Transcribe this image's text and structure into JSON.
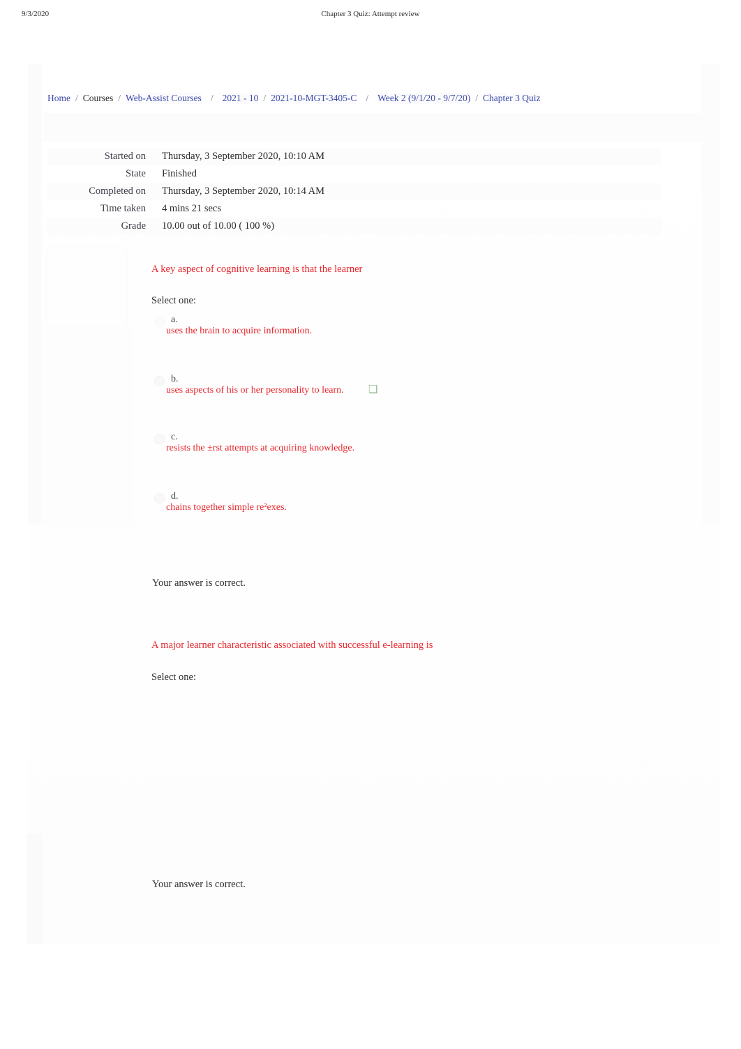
{
  "print_header": {
    "date": "9/3/2020",
    "title": "Chapter 3 Quiz: Attempt review"
  },
  "colors": {
    "link": "#3c4aa8",
    "question_text": "#e8262c",
    "body_text": "#2b2b2b",
    "correct_mark": "#8db48c",
    "page_background": "#ffffff"
  },
  "breadcrumb": {
    "items": [
      {
        "label": "Home",
        "type": "link"
      },
      {
        "label": "Courses",
        "type": "static"
      },
      {
        "label": "Web-Assist Courses",
        "type": "link"
      },
      {
        "label": "2021 - 10",
        "type": "link"
      },
      {
        "label": "2021-10-MGT-3405-C",
        "type": "link"
      },
      {
        "label": "Week 2  (9/1/20 - 9/7/20)",
        "type": "link"
      },
      {
        "label": "Chapter 3 Quiz",
        "type": "link"
      }
    ],
    "separator": "/"
  },
  "attempt_summary": {
    "rows": [
      {
        "label": "Started on",
        "value": "Thursday, 3 September 2020, 10:10 AM"
      },
      {
        "label": "State",
        "value": "Finished"
      },
      {
        "label": "Completed on",
        "value": "Thursday, 3 September 2020, 10:14 AM"
      },
      {
        "label": "Time taken",
        "value": "4 mins 21 secs"
      },
      {
        "label": "Grade",
        "value": "10.00  out of 10.00 (  100 %)"
      }
    ]
  },
  "questions": [
    {
      "text": "A key aspect of cognitive learning is that the learner",
      "select_prompt": "Select one:",
      "options": [
        {
          "letter": "a.",
          "text": "uses the brain to acquire information.",
          "correct_mark": ""
        },
        {
          "letter": "b.",
          "text": "uses aspects of his or her personality to learn.",
          "correct_mark": "❑"
        },
        {
          "letter": "c.",
          "text": "resists the ±rst attempts at acquiring knowledge.",
          "correct_mark": ""
        },
        {
          "letter": "d.",
          "text": "chains together simple re²exes.",
          "correct_mark": ""
        }
      ],
      "feedback": "Your answer is correct."
    },
    {
      "text": "A major learner characteristic associated with successful e-learning is",
      "select_prompt": "Select one:",
      "options": [],
      "feedback": "Your answer is correct."
    }
  ]
}
